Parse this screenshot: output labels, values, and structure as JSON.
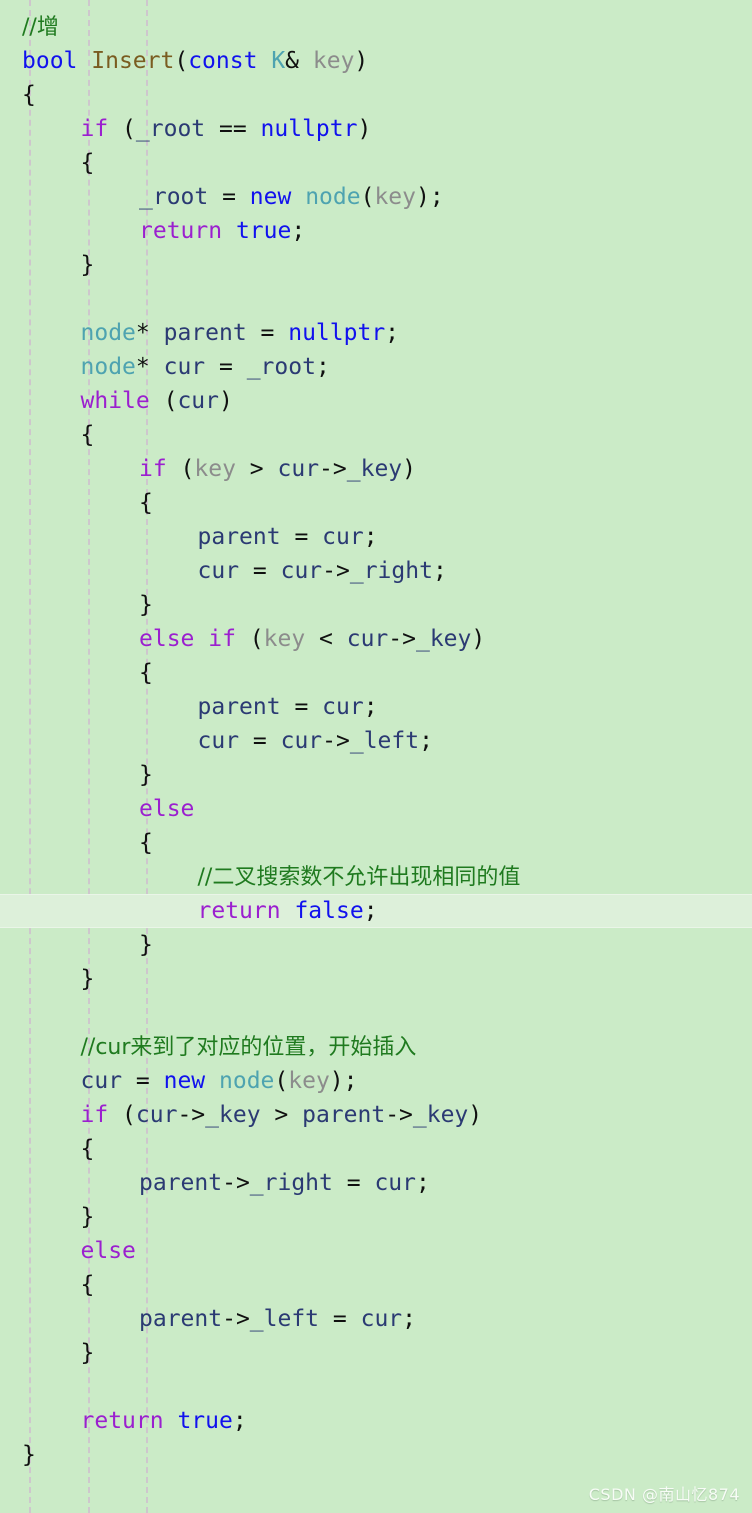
{
  "editor": {
    "language": "C++",
    "background_color": "#cbebc7",
    "current_line_color": "#ddf0da",
    "indent_guide_color": "#cfc0cf",
    "indent_guides_x": [
      29,
      88,
      146
    ],
    "current_line_number": 27
  },
  "palette": {
    "keyword": "#9b1fcf",
    "type_literal": "#1111ee",
    "class_name": "#4ea3b0",
    "function_name": "#7a5c20",
    "identifier": "#2b3a73",
    "parameter": "#8c8c8c",
    "comment": "#1f7a1f",
    "plain": "#101010"
  },
  "watermark": {
    "text": "CSDN @南山忆874"
  },
  "code": {
    "lines": [
      {
        "n": 1,
        "indent": 0,
        "current": false,
        "tokens": [
          {
            "c": "cmt",
            "t": "//增"
          }
        ]
      },
      {
        "n": 2,
        "indent": 0,
        "current": false,
        "tokens": [
          {
            "c": "type",
            "t": "bool"
          },
          {
            "c": "plain",
            "t": " "
          },
          {
            "c": "fn",
            "t": "Insert"
          },
          {
            "c": "plain",
            "t": "("
          },
          {
            "c": "type",
            "t": "const"
          },
          {
            "c": "plain",
            "t": " "
          },
          {
            "c": "cls",
            "t": "K"
          },
          {
            "c": "plain",
            "t": "& "
          },
          {
            "c": "param",
            "t": "key"
          },
          {
            "c": "plain",
            "t": ")"
          }
        ]
      },
      {
        "n": 3,
        "indent": 0,
        "current": false,
        "tokens": [
          {
            "c": "plain",
            "t": "{"
          }
        ]
      },
      {
        "n": 4,
        "indent": 1,
        "current": false,
        "tokens": [
          {
            "c": "kw",
            "t": "if"
          },
          {
            "c": "plain",
            "t": " ("
          },
          {
            "c": "var",
            "t": "_root"
          },
          {
            "c": "plain",
            "t": " == "
          },
          {
            "c": "type",
            "t": "nullptr"
          },
          {
            "c": "plain",
            "t": ")"
          }
        ]
      },
      {
        "n": 5,
        "indent": 1,
        "current": false,
        "tokens": [
          {
            "c": "plain",
            "t": "{"
          }
        ]
      },
      {
        "n": 6,
        "indent": 2,
        "current": false,
        "tokens": [
          {
            "c": "var",
            "t": "_root"
          },
          {
            "c": "plain",
            "t": " = "
          },
          {
            "c": "type",
            "t": "new"
          },
          {
            "c": "plain",
            "t": " "
          },
          {
            "c": "cls",
            "t": "node"
          },
          {
            "c": "plain",
            "t": "("
          },
          {
            "c": "param",
            "t": "key"
          },
          {
            "c": "plain",
            "t": ");"
          }
        ]
      },
      {
        "n": 7,
        "indent": 2,
        "current": false,
        "tokens": [
          {
            "c": "kw",
            "t": "return"
          },
          {
            "c": "plain",
            "t": " "
          },
          {
            "c": "type",
            "t": "true"
          },
          {
            "c": "plain",
            "t": ";"
          }
        ]
      },
      {
        "n": 8,
        "indent": 1,
        "current": false,
        "tokens": [
          {
            "c": "plain",
            "t": "}"
          }
        ]
      },
      {
        "n": 9,
        "indent": 0,
        "current": false,
        "tokens": []
      },
      {
        "n": 10,
        "indent": 1,
        "current": false,
        "tokens": [
          {
            "c": "cls",
            "t": "node"
          },
          {
            "c": "plain",
            "t": "* "
          },
          {
            "c": "var",
            "t": "parent"
          },
          {
            "c": "plain",
            "t": " = "
          },
          {
            "c": "type",
            "t": "nullptr"
          },
          {
            "c": "plain",
            "t": ";"
          }
        ]
      },
      {
        "n": 11,
        "indent": 1,
        "current": false,
        "tokens": [
          {
            "c": "cls",
            "t": "node"
          },
          {
            "c": "plain",
            "t": "* "
          },
          {
            "c": "var",
            "t": "cur"
          },
          {
            "c": "plain",
            "t": " = "
          },
          {
            "c": "var",
            "t": "_root"
          },
          {
            "c": "plain",
            "t": ";"
          }
        ]
      },
      {
        "n": 12,
        "indent": 1,
        "current": false,
        "tokens": [
          {
            "c": "kw",
            "t": "while"
          },
          {
            "c": "plain",
            "t": " ("
          },
          {
            "c": "var",
            "t": "cur"
          },
          {
            "c": "plain",
            "t": ")"
          }
        ]
      },
      {
        "n": 13,
        "indent": 1,
        "current": false,
        "tokens": [
          {
            "c": "plain",
            "t": "{"
          }
        ]
      },
      {
        "n": 14,
        "indent": 2,
        "current": false,
        "tokens": [
          {
            "c": "kw",
            "t": "if"
          },
          {
            "c": "plain",
            "t": " ("
          },
          {
            "c": "param",
            "t": "key"
          },
          {
            "c": "plain",
            "t": " > "
          },
          {
            "c": "var",
            "t": "cur"
          },
          {
            "c": "plain",
            "t": "->"
          },
          {
            "c": "var",
            "t": "_key"
          },
          {
            "c": "plain",
            "t": ")"
          }
        ]
      },
      {
        "n": 15,
        "indent": 2,
        "current": false,
        "tokens": [
          {
            "c": "plain",
            "t": "{"
          }
        ]
      },
      {
        "n": 16,
        "indent": 3,
        "current": false,
        "tokens": [
          {
            "c": "var",
            "t": "parent"
          },
          {
            "c": "plain",
            "t": " = "
          },
          {
            "c": "var",
            "t": "cur"
          },
          {
            "c": "plain",
            "t": ";"
          }
        ]
      },
      {
        "n": 17,
        "indent": 3,
        "current": false,
        "tokens": [
          {
            "c": "var",
            "t": "cur"
          },
          {
            "c": "plain",
            "t": " = "
          },
          {
            "c": "var",
            "t": "cur"
          },
          {
            "c": "plain",
            "t": "->"
          },
          {
            "c": "var",
            "t": "_right"
          },
          {
            "c": "plain",
            "t": ";"
          }
        ]
      },
      {
        "n": 18,
        "indent": 2,
        "current": false,
        "tokens": [
          {
            "c": "plain",
            "t": "}"
          }
        ]
      },
      {
        "n": 19,
        "indent": 2,
        "current": false,
        "tokens": [
          {
            "c": "kw",
            "t": "else if"
          },
          {
            "c": "plain",
            "t": " ("
          },
          {
            "c": "param",
            "t": "key"
          },
          {
            "c": "plain",
            "t": " < "
          },
          {
            "c": "var",
            "t": "cur"
          },
          {
            "c": "plain",
            "t": "->"
          },
          {
            "c": "var",
            "t": "_key"
          },
          {
            "c": "plain",
            "t": ")"
          }
        ]
      },
      {
        "n": 20,
        "indent": 2,
        "current": false,
        "tokens": [
          {
            "c": "plain",
            "t": "{"
          }
        ]
      },
      {
        "n": 21,
        "indent": 3,
        "current": false,
        "tokens": [
          {
            "c": "var",
            "t": "parent"
          },
          {
            "c": "plain",
            "t": " = "
          },
          {
            "c": "var",
            "t": "cur"
          },
          {
            "c": "plain",
            "t": ";"
          }
        ]
      },
      {
        "n": 22,
        "indent": 3,
        "current": false,
        "tokens": [
          {
            "c": "var",
            "t": "cur"
          },
          {
            "c": "plain",
            "t": " = "
          },
          {
            "c": "var",
            "t": "cur"
          },
          {
            "c": "plain",
            "t": "->"
          },
          {
            "c": "var",
            "t": "_left"
          },
          {
            "c": "plain",
            "t": ";"
          }
        ]
      },
      {
        "n": 23,
        "indent": 2,
        "current": false,
        "tokens": [
          {
            "c": "plain",
            "t": "}"
          }
        ]
      },
      {
        "n": 24,
        "indent": 2,
        "current": false,
        "tokens": [
          {
            "c": "kw",
            "t": "else"
          }
        ]
      },
      {
        "n": 25,
        "indent": 2,
        "current": false,
        "tokens": [
          {
            "c": "plain",
            "t": "{"
          }
        ]
      },
      {
        "n": 26,
        "indent": 3,
        "current": false,
        "tokens": [
          {
            "c": "cmt",
            "t": "//二叉搜索数不允许出现相同的值"
          }
        ]
      },
      {
        "n": 27,
        "indent": 3,
        "current": true,
        "tokens": [
          {
            "c": "kw",
            "t": "return"
          },
          {
            "c": "plain",
            "t": " "
          },
          {
            "c": "type",
            "t": "false"
          },
          {
            "c": "plain",
            "t": ";"
          }
        ]
      },
      {
        "n": 28,
        "indent": 2,
        "current": false,
        "tokens": [
          {
            "c": "plain",
            "t": "}"
          }
        ]
      },
      {
        "n": 29,
        "indent": 1,
        "current": false,
        "tokens": [
          {
            "c": "plain",
            "t": "}"
          }
        ]
      },
      {
        "n": 30,
        "indent": 0,
        "current": false,
        "tokens": []
      },
      {
        "n": 31,
        "indent": 1,
        "current": false,
        "tokens": [
          {
            "c": "cmt",
            "t": "//cur来到了对应的位置，开始插入"
          }
        ]
      },
      {
        "n": 32,
        "indent": 1,
        "current": false,
        "tokens": [
          {
            "c": "var",
            "t": "cur"
          },
          {
            "c": "plain",
            "t": " = "
          },
          {
            "c": "type",
            "t": "new"
          },
          {
            "c": "plain",
            "t": " "
          },
          {
            "c": "cls",
            "t": "node"
          },
          {
            "c": "plain",
            "t": "("
          },
          {
            "c": "param",
            "t": "key"
          },
          {
            "c": "plain",
            "t": ");"
          }
        ]
      },
      {
        "n": 33,
        "indent": 1,
        "current": false,
        "tokens": [
          {
            "c": "kw",
            "t": "if"
          },
          {
            "c": "plain",
            "t": " ("
          },
          {
            "c": "var",
            "t": "cur"
          },
          {
            "c": "plain",
            "t": "->"
          },
          {
            "c": "var",
            "t": "_key"
          },
          {
            "c": "plain",
            "t": " > "
          },
          {
            "c": "var",
            "t": "parent"
          },
          {
            "c": "plain",
            "t": "->"
          },
          {
            "c": "var",
            "t": "_key"
          },
          {
            "c": "plain",
            "t": ")"
          }
        ]
      },
      {
        "n": 34,
        "indent": 1,
        "current": false,
        "tokens": [
          {
            "c": "plain",
            "t": "{"
          }
        ]
      },
      {
        "n": 35,
        "indent": 2,
        "current": false,
        "tokens": [
          {
            "c": "var",
            "t": "parent"
          },
          {
            "c": "plain",
            "t": "->"
          },
          {
            "c": "var",
            "t": "_right"
          },
          {
            "c": "plain",
            "t": " = "
          },
          {
            "c": "var",
            "t": "cur"
          },
          {
            "c": "plain",
            "t": ";"
          }
        ]
      },
      {
        "n": 36,
        "indent": 1,
        "current": false,
        "tokens": [
          {
            "c": "plain",
            "t": "}"
          }
        ]
      },
      {
        "n": 37,
        "indent": 1,
        "current": false,
        "tokens": [
          {
            "c": "kw",
            "t": "else"
          }
        ]
      },
      {
        "n": 38,
        "indent": 1,
        "current": false,
        "tokens": [
          {
            "c": "plain",
            "t": "{"
          }
        ]
      },
      {
        "n": 39,
        "indent": 2,
        "current": false,
        "tokens": [
          {
            "c": "var",
            "t": "parent"
          },
          {
            "c": "plain",
            "t": "->"
          },
          {
            "c": "var",
            "t": "_left"
          },
          {
            "c": "plain",
            "t": " = "
          },
          {
            "c": "var",
            "t": "cur"
          },
          {
            "c": "plain",
            "t": ";"
          }
        ]
      },
      {
        "n": 40,
        "indent": 1,
        "current": false,
        "tokens": [
          {
            "c": "plain",
            "t": "}"
          }
        ]
      },
      {
        "n": 41,
        "indent": 0,
        "current": false,
        "tokens": []
      },
      {
        "n": 42,
        "indent": 1,
        "current": false,
        "tokens": [
          {
            "c": "kw",
            "t": "return"
          },
          {
            "c": "plain",
            "t": " "
          },
          {
            "c": "type",
            "t": "true"
          },
          {
            "c": "plain",
            "t": ";"
          }
        ]
      },
      {
        "n": 43,
        "indent": 0,
        "current": false,
        "tokens": [
          {
            "c": "plain",
            "t": "}"
          }
        ]
      }
    ]
  }
}
